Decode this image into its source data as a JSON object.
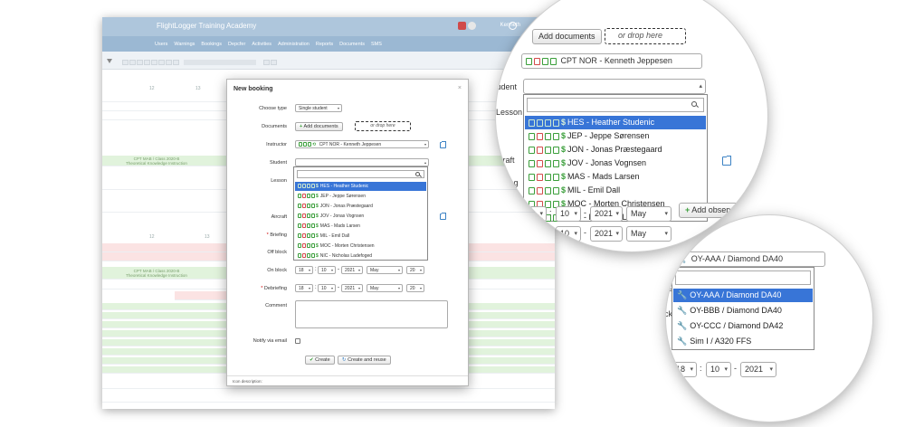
{
  "app": {
    "title": "FlightLogger Training Academy",
    "user": "Kenneth",
    "nav": [
      "Users",
      "Warnings",
      "Bookings",
      "Depcfer",
      "Activities",
      "Administration",
      "Reports",
      "Documents",
      "SMS"
    ],
    "timeline_labels": [
      "CPT MAB / Class 2020-B",
      "Theoretical Knowledge Instruction"
    ],
    "timeline_numbers": [
      "12",
      "13",
      "12",
      "13"
    ]
  },
  "dialog": {
    "title": "New booking",
    "close": "×",
    "labels": {
      "choose_type": "Choose type",
      "documents": "Documents",
      "instructor": "Instructor",
      "student": "Student",
      "lesson": "Lesson",
      "aircraft": "Aircraft",
      "briefing": "Briefing",
      "off_block": "Off block",
      "on_block": "On block",
      "debriefing": "Debriefing",
      "comment": "Comment",
      "notify": "Notify via email"
    },
    "required_mark": "*",
    "type_value": "Single student",
    "add_documents": "Add documents",
    "drop_here": "or drop here",
    "instructor_value": "CPT NOR - Kenneth Jeppesen",
    "on_block": {
      "day": "18",
      "month_num": "10",
      "year": "2021",
      "month": "May",
      "hour": "20"
    },
    "debriefing": {
      "day": "18",
      "month_num": "10",
      "year": "2021",
      "month": "May",
      "hour": "20"
    },
    "create": "Create",
    "create_reuse": "Create and reuse",
    "icon_description": "Icon description:"
  },
  "students": [
    {
      "label": "HES - Heather Studenic",
      "selected": true
    },
    {
      "label": "JEP - Jeppe Sørensen",
      "selected": false
    },
    {
      "label": "JON - Jonas Præstegaard",
      "selected": false
    },
    {
      "label": "JOV - Jonas Vognsen",
      "selected": false
    },
    {
      "label": "MAS - Mads Larsen",
      "selected": false
    },
    {
      "label": "MIL - Emil Dall",
      "selected": false
    },
    {
      "label": "MOC - Morten Christensen",
      "selected": false
    },
    {
      "label": "NIC - Nicholas Ladefoged",
      "selected": false
    }
  ],
  "zoom1": {
    "add_documents": "Add documents",
    "drop_here": "or drop here",
    "instructor_value": "CPT NOR - Kenneth Jeppesen",
    "labels": {
      "student": "Student",
      "lesson": "Lesson",
      "aircraft": "Aircraft",
      "briefing": "Briefing",
      "block": "block"
    },
    "date": {
      "day": "18",
      "month_num": "10",
      "year": "2021",
      "month": "May"
    },
    "date2": {
      "day": "18",
      "month_num": "10",
      "year": "2021",
      "month": "May"
    },
    "add_observer": "Add observer",
    "sep": ":",
    "dash": "-"
  },
  "zoom2": {
    "selected": "OY-AAA / Diamond DA40",
    "aircraft": [
      {
        "label": "OY-AAA / Diamond DA40",
        "selected": true
      },
      {
        "label": "OY-BBB / Diamond DA40",
        "selected": false
      },
      {
        "label": "OY-CCC / Diamond DA42",
        "selected": false
      },
      {
        "label": "Sim I / A320 FFS",
        "selected": false
      }
    ],
    "date": {
      "day": "18",
      "month_num": "10",
      "year": "2021"
    },
    "frag_labels": [
      "ng",
      "ck"
    ]
  },
  "colors": {
    "selected_bg": "#3875d7",
    "topbar": "#aec6dc",
    "icon_green": "#3a9e3a",
    "icon_red": "#d34a4a"
  }
}
